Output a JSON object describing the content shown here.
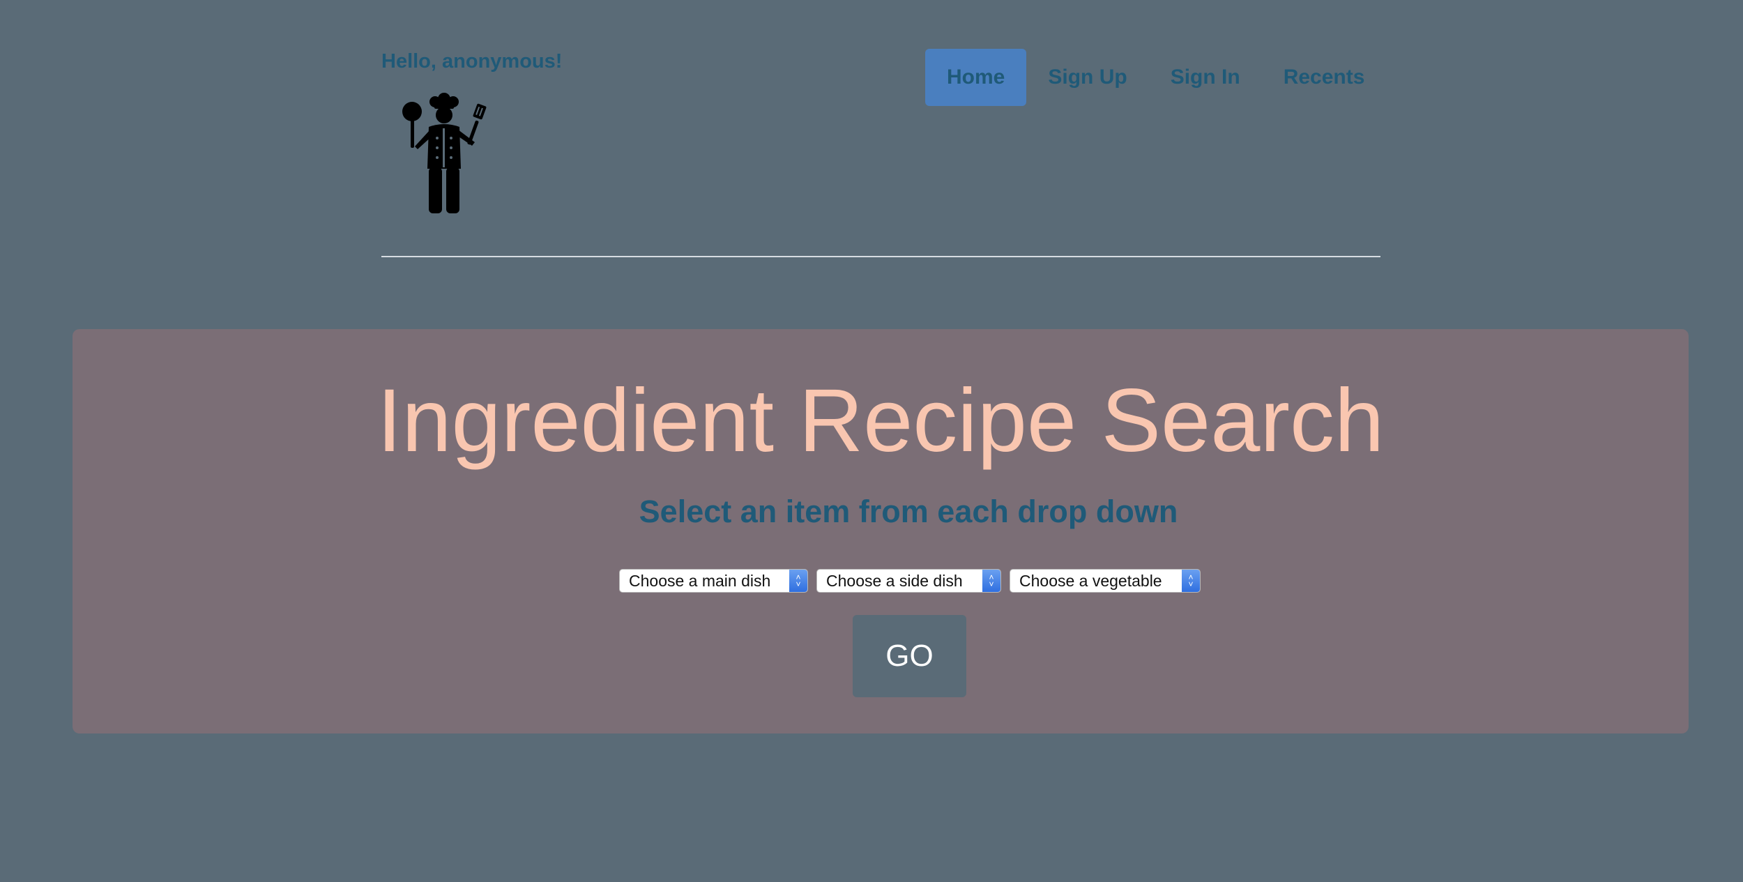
{
  "header": {
    "greeting": "Hello, anonymous!",
    "logo_icon": "chef-icon",
    "nav": [
      {
        "label": "Home",
        "active": true
      },
      {
        "label": "Sign Up",
        "active": false
      },
      {
        "label": "Sign In",
        "active": false
      },
      {
        "label": "Recents",
        "active": false
      }
    ]
  },
  "main": {
    "title": "Ingredient Recipe Search",
    "subtitle": "Select an item from each drop down",
    "selects": [
      {
        "value": "Choose a main dish"
      },
      {
        "value": "Choose a side dish"
      },
      {
        "value": "Choose a vegetable"
      }
    ],
    "go_label": "GO"
  },
  "colors": {
    "background": "#5a6b77",
    "panel": "#7b6e76",
    "title": "#f9c6b0",
    "link": "#1f5a78",
    "nav_active": "#4a7fbf"
  }
}
